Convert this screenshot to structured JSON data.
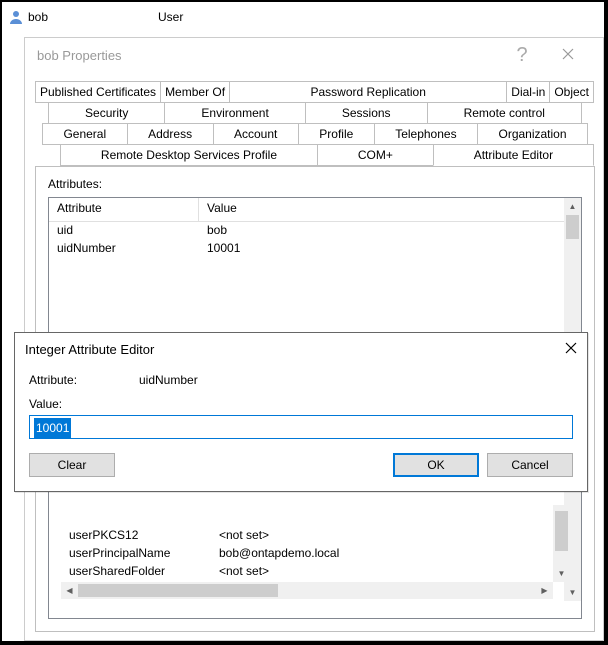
{
  "header": {
    "object_name": "bob",
    "object_type": "User"
  },
  "props": {
    "title": "bob Properties",
    "help": "?",
    "tabs_row1": [
      "Published Certificates",
      "Member Of",
      "Password Replication",
      "Dial-in",
      "Object"
    ],
    "tabs_row2": [
      "Security",
      "Environment",
      "Sessions",
      "Remote control"
    ],
    "tabs_row3": [
      "General",
      "Address",
      "Account",
      "Profile",
      "Telephones",
      "Organization"
    ],
    "tabs_row4": [
      "Remote Desktop Services Profile",
      "COM+",
      "Attribute Editor"
    ],
    "active_tab": "Attribute Editor",
    "attributes_label": "Attributes:",
    "col_attr": "Attribute",
    "col_val": "Value",
    "rows_top": [
      {
        "attr": "uid",
        "val": "bob"
      },
      {
        "attr": "uidNumber",
        "val": "10001"
      }
    ],
    "rows_bottom": [
      {
        "attr": "userPKCS12",
        "val": "<not set>"
      },
      {
        "attr": "userPrincipalName",
        "val": "bob@ontapdemo.local"
      },
      {
        "attr": "userSharedFolder",
        "val": "<not set>"
      }
    ]
  },
  "editor": {
    "title": "Integer Attribute Editor",
    "attr_label": "Attribute:",
    "attr_name": "uidNumber",
    "value_label": "Value:",
    "value": "10001",
    "clear": "Clear",
    "ok": "OK",
    "cancel": "Cancel"
  }
}
